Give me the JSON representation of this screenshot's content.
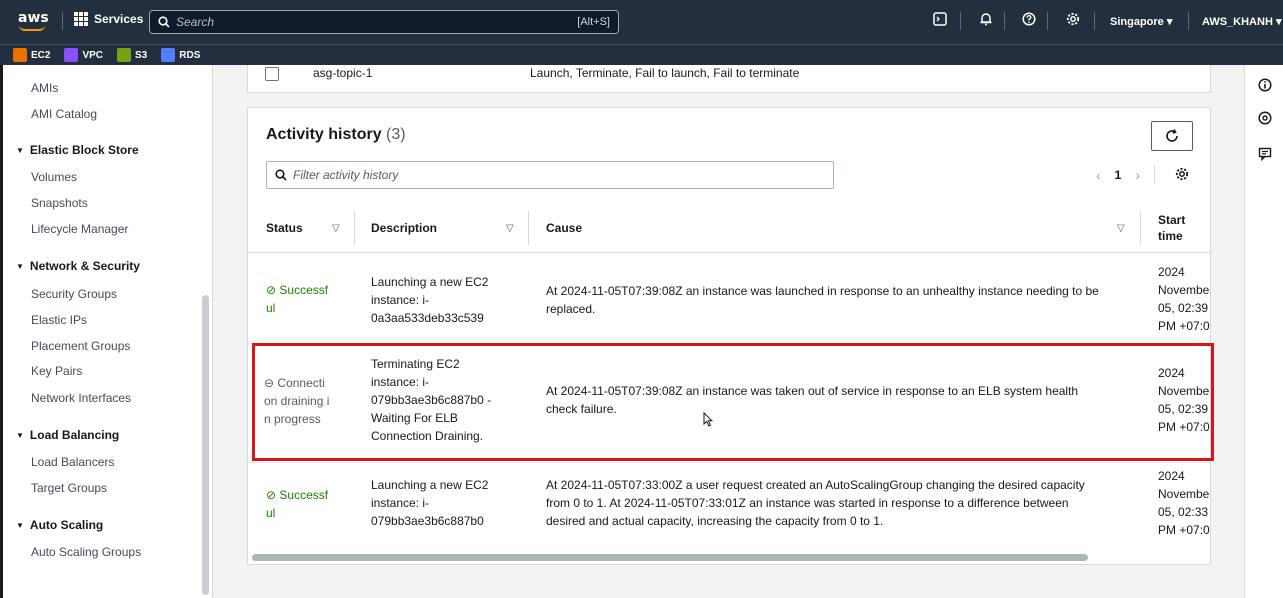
{
  "topnav": {
    "logo_text": "aws",
    "services_label": "Services",
    "search_placeholder": "Search",
    "search_shortcut": "[Alt+S]",
    "region": "Singapore ▾",
    "account": "AWS_KHANH ▾",
    "icons": [
      "cloudshell-icon",
      "notifications-icon",
      "help-icon",
      "settings-icon"
    ]
  },
  "favorites": [
    {
      "label": "EC2",
      "color": "#ed7100"
    },
    {
      "label": "VPC",
      "color": "#8c4fff"
    },
    {
      "label": "S3",
      "color": "#7aa116"
    },
    {
      "label": "RDS",
      "color": "#527fff"
    }
  ],
  "sidebar": {
    "items_top": [
      "AMIs",
      "AMI Catalog"
    ],
    "ebs": {
      "title": "Elastic Block Store",
      "items": [
        "Volumes",
        "Snapshots",
        "Lifecycle Manager"
      ]
    },
    "netsec": {
      "title": "Network & Security",
      "items": [
        "Security Groups",
        "Elastic IPs",
        "Placement Groups",
        "Key Pairs",
        "Network Interfaces"
      ]
    },
    "lb": {
      "title": "Load Balancing",
      "items": [
        "Load Balancers",
        "Target Groups"
      ]
    },
    "as": {
      "title": "Auto Scaling",
      "items": [
        "Auto Scaling Groups"
      ]
    }
  },
  "notification_row": {
    "name": "asg-topic-1",
    "types": "Launch, Terminate, Fail to launch, Fail to terminate"
  },
  "activity": {
    "title": "Activity history",
    "count": "(3)",
    "filter_placeholder": "Filter activity history",
    "page": "1",
    "columns": {
      "status": "Status",
      "description": "Description",
      "cause": "Cause",
      "start_time_1": "Start",
      "start_time_2": "time"
    },
    "rows": [
      {
        "status_1": "Successf",
        "status_2": "ul",
        "desc": [
          "Launching a new EC2",
          "instance: i-",
          "0a3aa533deb33c539"
        ],
        "cause": [
          "At 2024-11-05T07:39:08Z an instance was launched in response to an unhealthy instance needing to be",
          "replaced."
        ],
        "time": [
          "2024",
          "Novembe",
          "05, 02:39",
          "PM +07:0"
        ]
      },
      {
        "status_1": "Connecti",
        "status_2": "on draining i",
        "status_3": "n progress",
        "desc": [
          "Terminating EC2",
          "instance: i-",
          "079bb3ae3b6c887b0 -",
          "Waiting For ELB",
          "Connection Draining."
        ],
        "cause": [
          "At 2024-11-05T07:39:08Z an instance was taken out of service in response to an ELB system health",
          "check failure."
        ],
        "time": [
          "2024",
          "Novembe",
          "05, 02:39",
          "PM +07:0"
        ]
      },
      {
        "status_1": "Successf",
        "status_2": "ul",
        "desc": [
          "Launching a new EC2",
          "instance: i-",
          "079bb3ae3b6c887b0"
        ],
        "cause": [
          "At 2024-11-05T07:33:00Z a user request created an AutoScalingGroup changing the desired capacity",
          "from 0 to 1. At 2024-11-05T07:33:01Z an instance was started in response to a difference between",
          "desired and actual capacity, increasing the capacity from 0 to 1."
        ],
        "time": [
          "2024",
          "Novembe",
          "05, 02:33",
          "PM +07:0"
        ]
      }
    ]
  },
  "colors": {
    "nav": "#232f3e",
    "success": "#1d8102",
    "highlight": "#d91515",
    "accent": "#ff9900"
  }
}
